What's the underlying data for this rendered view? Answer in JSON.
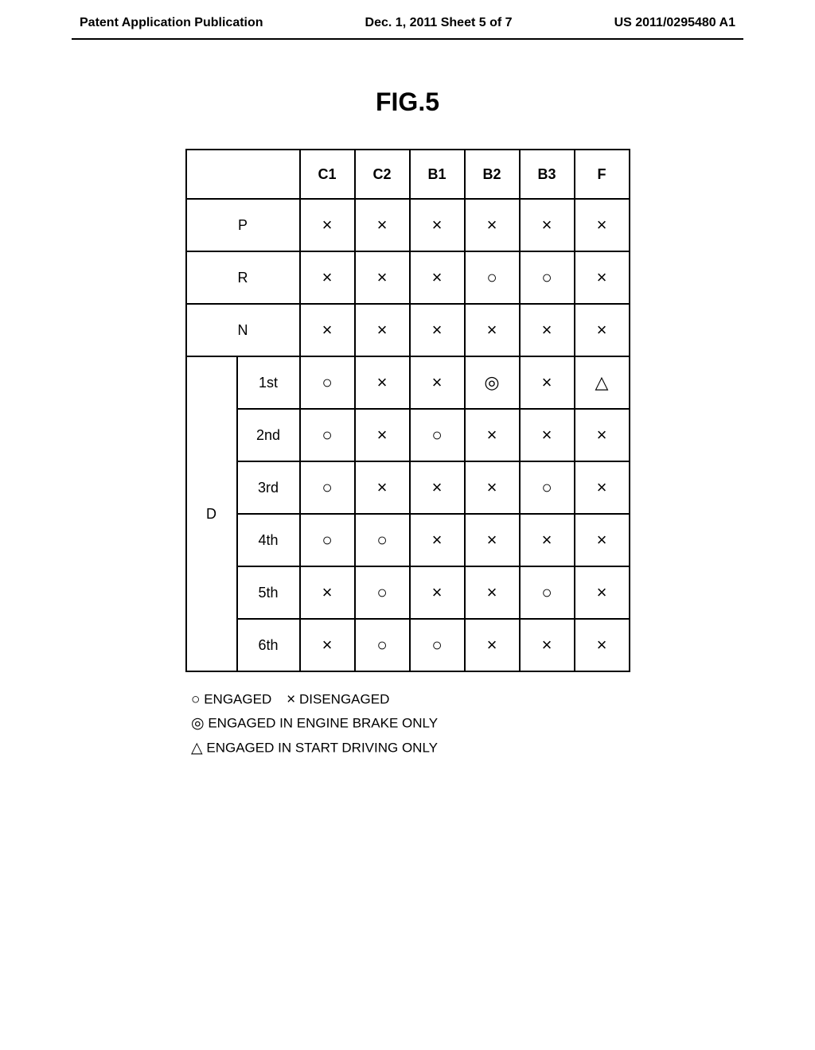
{
  "header": {
    "left": "Patent Application Publication",
    "center": "Dec. 1, 2011  Sheet 5 of 7",
    "right": "US 2011/0295480 A1"
  },
  "figure_title": "FIG.5",
  "table": {
    "columns": [
      "C1",
      "C2",
      "B1",
      "B2",
      "B3",
      "F"
    ],
    "rows": [
      {
        "label1": "",
        "label2": "P",
        "span": "merge",
        "cells": [
          "×",
          "×",
          "×",
          "×",
          "×",
          "×"
        ]
      },
      {
        "label1": "",
        "label2": "R",
        "span": "merge",
        "cells": [
          "×",
          "×",
          "×",
          "○",
          "○",
          "×"
        ]
      },
      {
        "label1": "",
        "label2": "N",
        "span": "merge",
        "cells": [
          "×",
          "×",
          "×",
          "×",
          "×",
          "×"
        ]
      },
      {
        "label1": "D",
        "label2": "1st",
        "span": "group",
        "cells": [
          "○",
          "×",
          "×",
          "◎",
          "×",
          "△"
        ]
      },
      {
        "label1": "",
        "label2": "2nd",
        "span": "group",
        "cells": [
          "○",
          "×",
          "○",
          "×",
          "×",
          "×"
        ]
      },
      {
        "label1": "",
        "label2": "3rd",
        "span": "group",
        "cells": [
          "○",
          "×",
          "×",
          "×",
          "○",
          "×"
        ]
      },
      {
        "label1": "",
        "label2": "4th",
        "span": "group",
        "cells": [
          "○",
          "○",
          "×",
          "×",
          "×",
          "×"
        ]
      },
      {
        "label1": "",
        "label2": "5th",
        "span": "group",
        "cells": [
          "×",
          "○",
          "×",
          "×",
          "○",
          "×"
        ]
      },
      {
        "label1": "",
        "label2": "6th",
        "span": "group",
        "cells": [
          "×",
          "○",
          "○",
          "×",
          "×",
          "×"
        ]
      }
    ]
  },
  "legend": {
    "line1_sym1": "○",
    "line1_text1": "ENGAGED",
    "line1_sym2": "×",
    "line1_text2": "DISENGAGED",
    "line2_sym": "◎",
    "line2_text": "ENGAGED IN ENGINE BRAKE ONLY",
    "line3_sym": "△",
    "line3_text": "ENGAGED IN START DRIVING ONLY"
  },
  "chart_data": {
    "type": "table",
    "title": "FIG.5",
    "columns": [
      "C1",
      "C2",
      "B1",
      "B2",
      "B3",
      "F"
    ],
    "rows": [
      {
        "mode": "P",
        "values": [
          "disengaged",
          "disengaged",
          "disengaged",
          "disengaged",
          "disengaged",
          "disengaged"
        ]
      },
      {
        "mode": "R",
        "values": [
          "disengaged",
          "disengaged",
          "disengaged",
          "engaged",
          "engaged",
          "disengaged"
        ]
      },
      {
        "mode": "N",
        "values": [
          "disengaged",
          "disengaged",
          "disengaged",
          "disengaged",
          "disengaged",
          "disengaged"
        ]
      },
      {
        "mode": "D",
        "gear": "1st",
        "values": [
          "engaged",
          "disengaged",
          "disengaged",
          "engaged_engine_brake_only",
          "disengaged",
          "engaged_start_driving_only"
        ]
      },
      {
        "mode": "D",
        "gear": "2nd",
        "values": [
          "engaged",
          "disengaged",
          "engaged",
          "disengaged",
          "disengaged",
          "disengaged"
        ]
      },
      {
        "mode": "D",
        "gear": "3rd",
        "values": [
          "engaged",
          "disengaged",
          "disengaged",
          "disengaged",
          "engaged",
          "disengaged"
        ]
      },
      {
        "mode": "D",
        "gear": "4th",
        "values": [
          "engaged",
          "engaged",
          "disengaged",
          "disengaged",
          "disengaged",
          "disengaged"
        ]
      },
      {
        "mode": "D",
        "gear": "5th",
        "values": [
          "disengaged",
          "engaged",
          "disengaged",
          "disengaged",
          "engaged",
          "disengaged"
        ]
      },
      {
        "mode": "D",
        "gear": "6th",
        "values": [
          "disengaged",
          "engaged",
          "engaged",
          "disengaged",
          "disengaged",
          "disengaged"
        ]
      }
    ],
    "legend": {
      "○": "engaged",
      "×": "disengaged",
      "◎": "engaged in engine brake only",
      "△": "engaged in start driving only"
    }
  }
}
